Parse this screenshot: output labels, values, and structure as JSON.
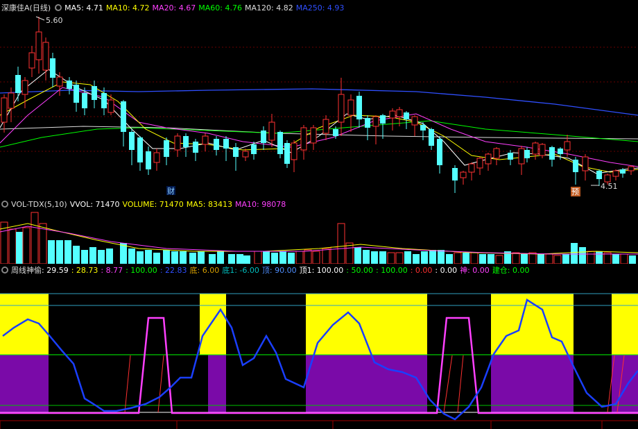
{
  "main": {
    "stock": "深康佳A(日线)",
    "ma": [
      {
        "label": "MA5: 4.71",
        "color": "#ffffff"
      },
      {
        "label": "MA10: 4.72",
        "color": "#ffff00"
      },
      {
        "label": "MA20: 4.67",
        "color": "#ff40ff"
      },
      {
        "label": "MA60: 4.76",
        "color": "#00ff00"
      },
      {
        "label": "MA120: 4.82",
        "color": "#dddddd"
      },
      {
        "label": "MA250: 4.93",
        "color": "#2f4fff"
      }
    ],
    "high_label": "5.60",
    "low_label": "4.51",
    "marker_cai": "财",
    "marker_yu": "预"
  },
  "volume": {
    "title": "VOL-TDX(5,10)",
    "items": [
      {
        "label": "VVOL: 71470",
        "color": "#ffffff"
      },
      {
        "label": "VOLUME: 71470",
        "color": "#ffff00"
      },
      {
        "label": "MA5: 83413",
        "color": "#ffff00"
      },
      {
        "label": "MA10: 98078",
        "color": "#ff40ff"
      }
    ]
  },
  "indicator": {
    "title": "周线神偷",
    "items": [
      {
        "label": ": 29.59",
        "color": "#ffffff"
      },
      {
        "label": ": 28.73",
        "color": "#ffff00"
      },
      {
        "label": ": 8.77",
        "color": "#ff40ff"
      },
      {
        "label": ": 100.00",
        "color": "#00ff00"
      },
      {
        "label": ": 22.83",
        "color": "#2f4fff"
      },
      {
        "label": "底: 6.00",
        "color": "#d8a000"
      },
      {
        "label": "底1: -6.00",
        "color": "#00c0c0"
      },
      {
        "label": "顶: 90.00",
        "color": "#4f8fff"
      },
      {
        "label": "顶1: 100.00",
        "color": "#ffffff"
      },
      {
        "label": ": 50.00",
        "color": "#00ff00"
      },
      {
        "label": ": 100.00",
        "color": "#00ff00"
      },
      {
        "label": ": 0.00",
        "color": "#ff3030"
      },
      {
        "label": ": 0.00",
        "color": "#ffffff"
      },
      {
        "label": "神: 0.00",
        "color": "#ff40ff"
      },
      {
        "label": "建仓: 0.00",
        "color": "#00ff00"
      }
    ]
  }
}
